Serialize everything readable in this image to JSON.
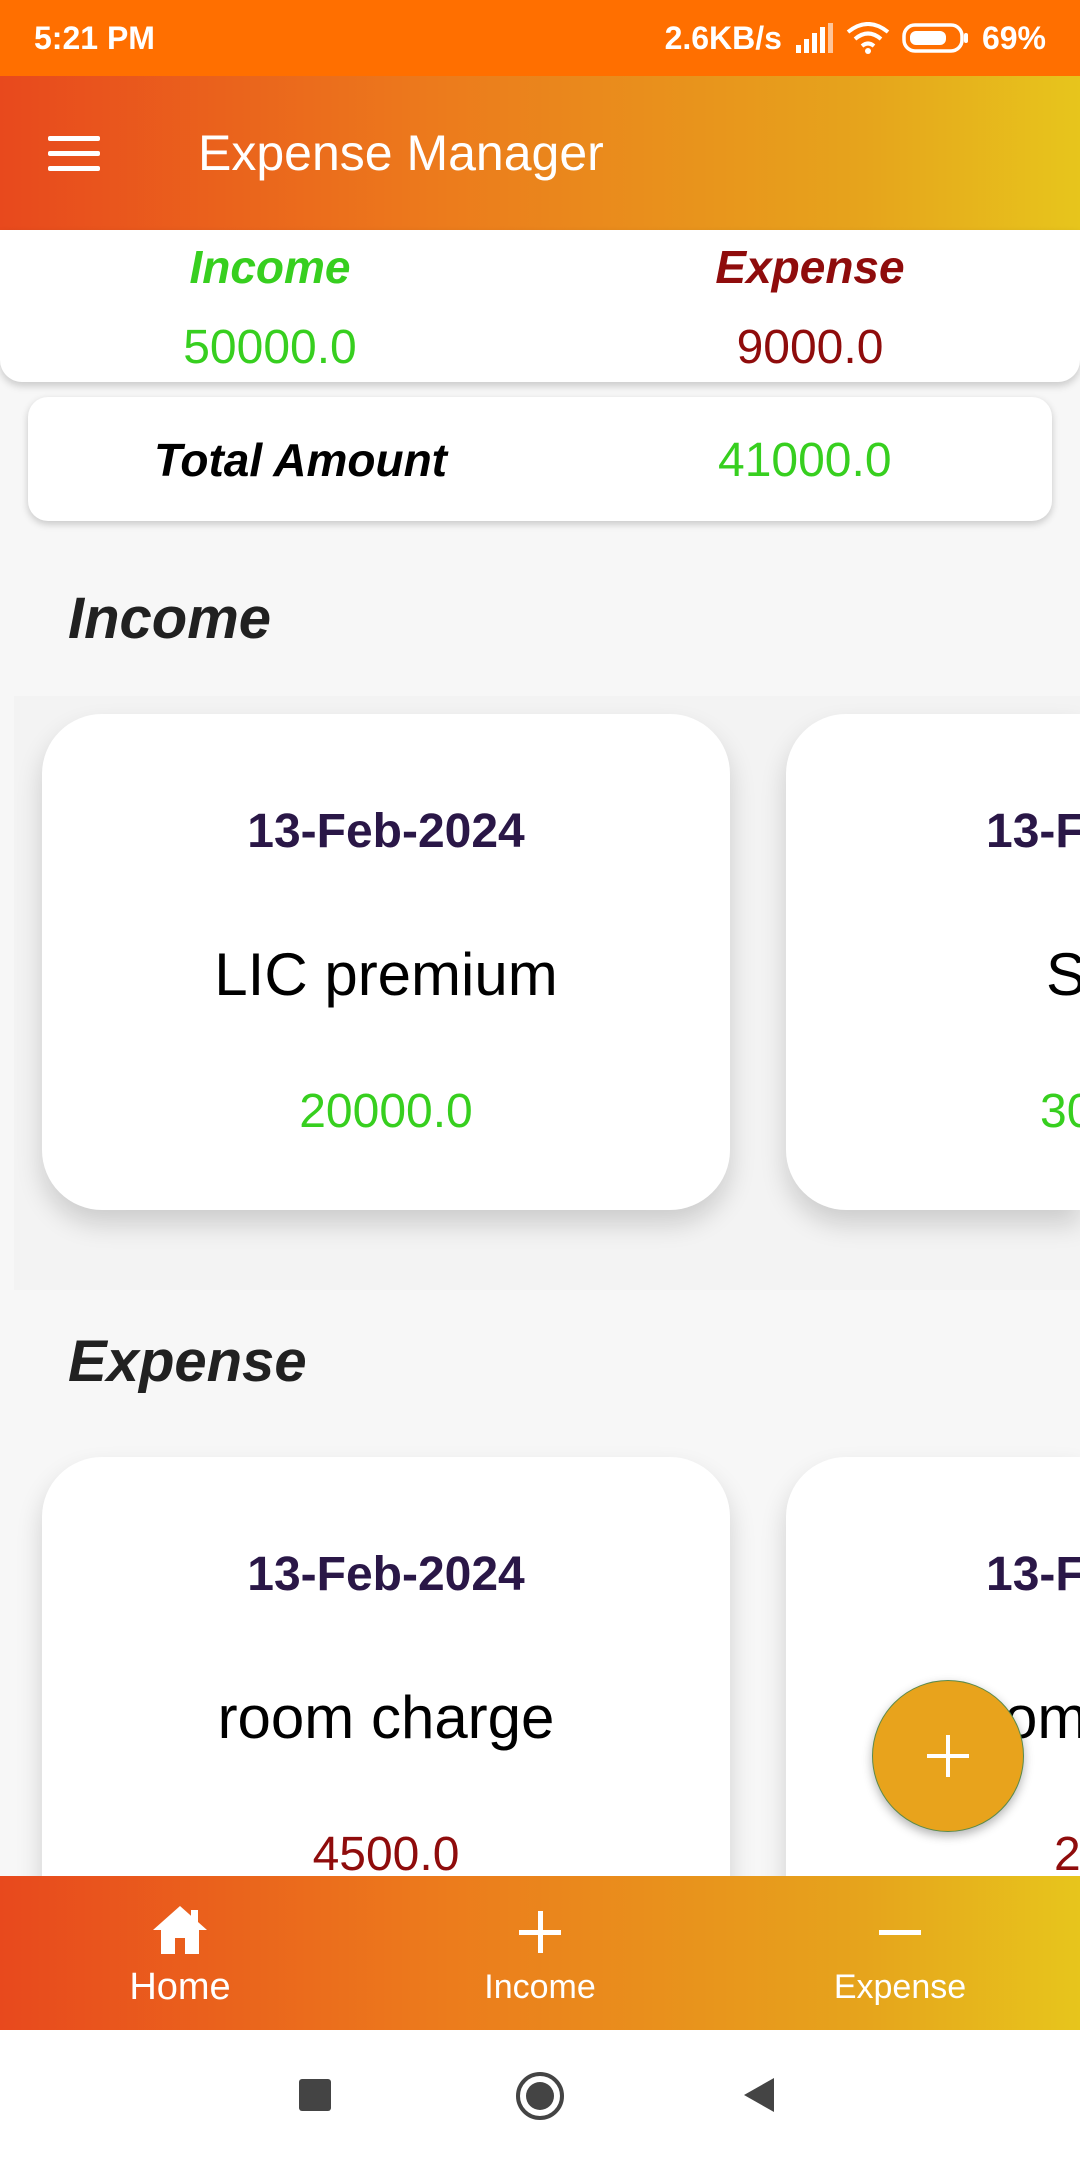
{
  "status_bar": {
    "time": "5:21 PM",
    "net_speed": "2.6KB/s",
    "battery": "69%"
  },
  "app_bar": {
    "title": "Expense Manager"
  },
  "summary": {
    "income_label": "Income",
    "income_value": "50000.0",
    "expense_label": "Expense",
    "expense_value": "9000.0"
  },
  "total": {
    "label": "Total Amount",
    "value": "41000.0"
  },
  "income_section": {
    "title": "Income",
    "cards": [
      {
        "date": "13-Feb-2024",
        "title": "LIC premium",
        "amount": "20000.0"
      },
      {
        "date": "13-F",
        "title": "S",
        "amount": "30"
      }
    ]
  },
  "expense_section": {
    "title": "Expense",
    "cards": [
      {
        "date": "13-Feb-2024",
        "title": "room charge",
        "amount": "4500.0"
      },
      {
        "date": "13-F",
        "title": "om",
        "amount": "2"
      }
    ]
  },
  "bottom_nav": {
    "home": "Home",
    "income": "Income",
    "expense": "Expense"
  },
  "colors": {
    "income": "#37cf1f",
    "expense": "#8f0c0c",
    "accent": "#e8a31c",
    "status_bar": "#ff6f00"
  }
}
